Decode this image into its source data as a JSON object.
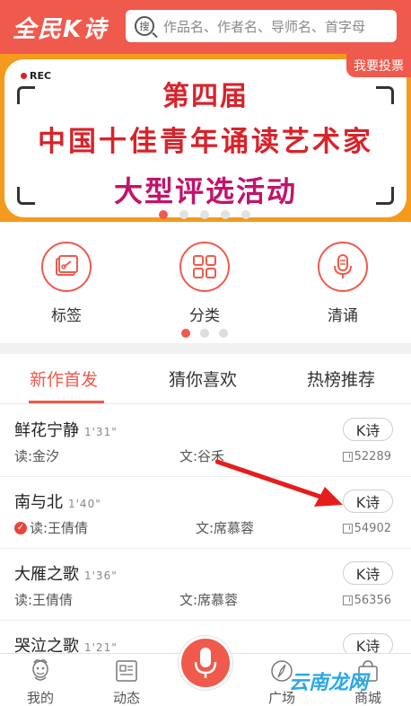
{
  "header": {
    "logo": "全民K诗",
    "search_placeholder": "作品名、作者名、导师名、首字母"
  },
  "banner": {
    "rec": "REC",
    "vote_label": "我要投票",
    "line1": "第四届",
    "line2": "中国十佳青年诵读艺术家",
    "line3": "大型评选活动",
    "slide_count": 5,
    "active_slide": 0,
    "colors": {
      "border": "#f49a1c",
      "text_red": "#d8232a",
      "text_magenta": "#c2136b"
    }
  },
  "categories": {
    "items": [
      {
        "label": "标签",
        "icon": "tag-icon"
      },
      {
        "label": "分类",
        "icon": "grid-icon"
      },
      {
        "label": "清诵",
        "icon": "microphone-icon"
      }
    ],
    "page_count": 3,
    "active_page": 0
  },
  "tabs": [
    {
      "label": "新作首发",
      "active": true
    },
    {
      "label": "猜你喜欢",
      "active": false
    },
    {
      "label": "热榜推荐",
      "active": false
    }
  ],
  "list": [
    {
      "title": "鲜花宁静",
      "duration": "1'31\"",
      "reader": "读:金汐",
      "author": "文:谷禾",
      "button": "K诗",
      "downloads": "52289",
      "verified": false
    },
    {
      "title": "南与北",
      "duration": "1'40\"",
      "reader": "读:王倩倩",
      "author": "文:席慕蓉",
      "button": "K诗",
      "downloads": "54902",
      "verified": true
    },
    {
      "title": "大雁之歌",
      "duration": "1'36\"",
      "reader": "读:王倩倩",
      "author": "文:席慕蓉",
      "button": "K诗",
      "downloads": "56356",
      "verified": false
    },
    {
      "title": "哭泣之歌",
      "duration": "1'21\"",
      "reader": "",
      "author": "",
      "button": "K诗",
      "downloads": "",
      "verified": false
    }
  ],
  "nav": [
    {
      "label": "我的",
      "icon": "profile-icon"
    },
    {
      "label": "动态",
      "icon": "feed-icon"
    },
    {
      "label": "",
      "icon": "microphone-icon"
    },
    {
      "label": "广场",
      "icon": "compass-icon"
    },
    {
      "label": "商城",
      "icon": "shopping-bag-icon"
    }
  ],
  "watermark": "云南龙网",
  "accent_color": "#ef5a4c"
}
